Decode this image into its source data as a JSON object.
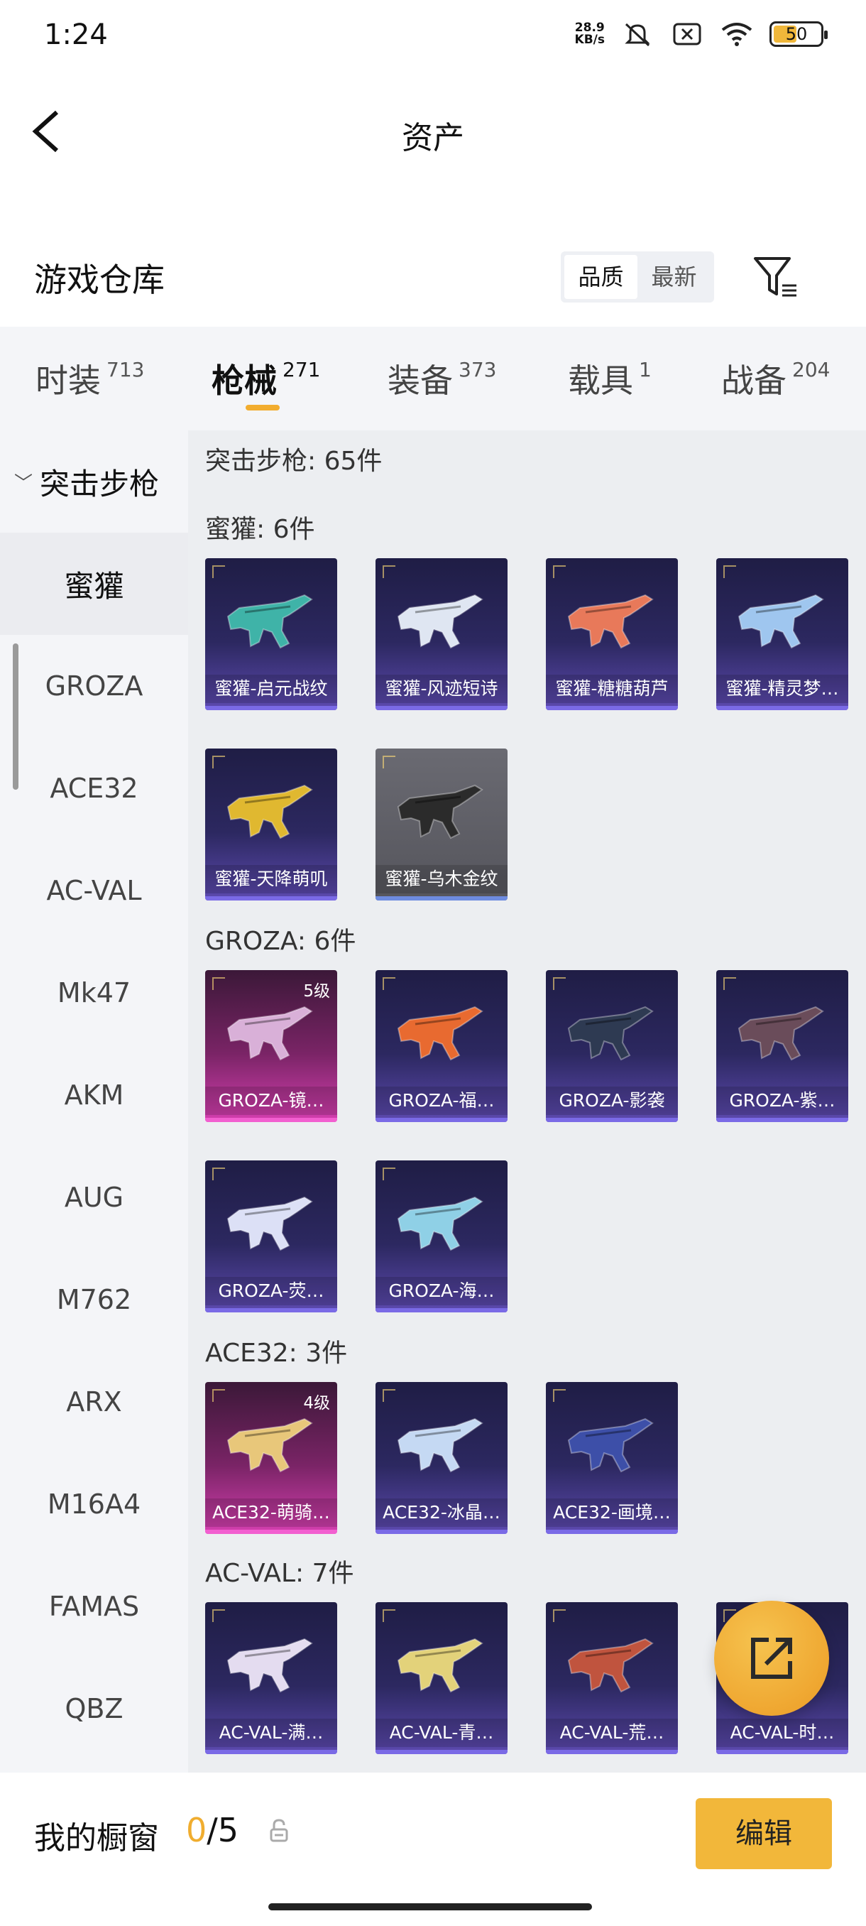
{
  "status": {
    "time": "1:24",
    "netspeed_value": "28.9",
    "netspeed_unit": "KB/s",
    "battery": "50",
    "battery_level": 0.5,
    "icons": [
      "mute-icon",
      "sim-off-icon",
      "wifi-icon",
      "battery-icon"
    ]
  },
  "nav": {
    "title": "资产",
    "back_icon": "chevron-left-icon"
  },
  "warehouse": {
    "title": "游戏仓库",
    "sort_options": [
      "品质",
      "最新"
    ],
    "sort_selected": "品质",
    "filter_icon": "filter-icon"
  },
  "tabs": [
    {
      "label": "时装",
      "count": "713"
    },
    {
      "label": "枪械",
      "count": "271",
      "active": true
    },
    {
      "label": "装备",
      "count": "373"
    },
    {
      "label": "载具",
      "count": "1"
    },
    {
      "label": "战备",
      "count": "204"
    }
  ],
  "sidebar": {
    "header": "突击步枪",
    "items": [
      "蜜獾",
      "GROZA",
      "ACE32",
      "AC-VAL",
      "Mk47",
      "AKM",
      "AUG",
      "M762",
      "ARX",
      "M16A4",
      "FAMAS",
      "QBZ"
    ],
    "active": "蜜獾"
  },
  "main": {
    "total_label": "突击步枪: 65件",
    "sections": [
      {
        "label": "蜜獾: 6件",
        "items": [
          {
            "name": "蜜獾-启元战纹",
            "level": "",
            "style": "purple",
            "gun": "#3fb3a8"
          },
          {
            "name": "蜜獾-风迹短诗",
            "level": "",
            "style": "purple",
            "gun": "#dfe6f2"
          },
          {
            "name": "蜜獾-糖糖葫芦",
            "level": "",
            "style": "purple",
            "gun": "#e8795a"
          },
          {
            "name": "蜜獾-精灵梦…",
            "level": "",
            "style": "purple",
            "gun": "#9fc6ef"
          },
          {
            "name": "蜜獾-天降萌叽",
            "level": "",
            "style": "purple",
            "gun": "#e0b830"
          },
          {
            "name": "蜜獾-乌木金纹",
            "level": "",
            "style": "gray",
            "gun": "#2b2b2b"
          }
        ]
      },
      {
        "label": "GROZA: 6件",
        "items": [
          {
            "name": "GROZA-镜…",
            "level": "5级",
            "style": "pink",
            "gun": "#d9b0d8"
          },
          {
            "name": "GROZA-福…",
            "level": "",
            "style": "purple",
            "gun": "#e86a30"
          },
          {
            "name": "GROZA-影袭",
            "level": "",
            "style": "purple",
            "gun": "#2e3a52"
          },
          {
            "name": "GROZA-紫…",
            "level": "",
            "style": "purple",
            "gun": "#6a4c5a"
          },
          {
            "name": "GROZA-荧…",
            "level": "",
            "style": "purple",
            "gun": "#dce0f6"
          },
          {
            "name": "GROZA-海…",
            "level": "",
            "style": "purple",
            "gun": "#8fd0e6"
          }
        ]
      },
      {
        "label": "ACE32: 3件",
        "items": [
          {
            "name": "ACE32-萌骑…",
            "level": "4级",
            "style": "pink",
            "gun": "#e8c77a"
          },
          {
            "name": "ACE32-冰晶…",
            "level": "",
            "style": "purple",
            "gun": "#c5d9f3"
          },
          {
            "name": "ACE32-画境…",
            "level": "",
            "style": "purple",
            "gun": "#3d4fa8"
          }
        ]
      },
      {
        "label": "AC-VAL: 7件",
        "items": [
          {
            "name": "AC-VAL-满…",
            "level": "",
            "style": "purple",
            "gun": "#e4dcf0"
          },
          {
            "name": "AC-VAL-青…",
            "level": "",
            "style": "purple",
            "gun": "#e3d27a"
          },
          {
            "name": "AC-VAL-荒…",
            "level": "",
            "style": "purple",
            "gun": "#c0543e"
          },
          {
            "name": "AC-VAL-时…",
            "level": "",
            "style": "purple",
            "gun": "#d6c6ea"
          }
        ]
      }
    ]
  },
  "fab": {
    "icon": "share-icon"
  },
  "showcase": {
    "label": "我的橱窗",
    "current": "0",
    "separator": "/",
    "max": "5",
    "lock_icon": "lock-icon",
    "edit_label": "编辑"
  }
}
